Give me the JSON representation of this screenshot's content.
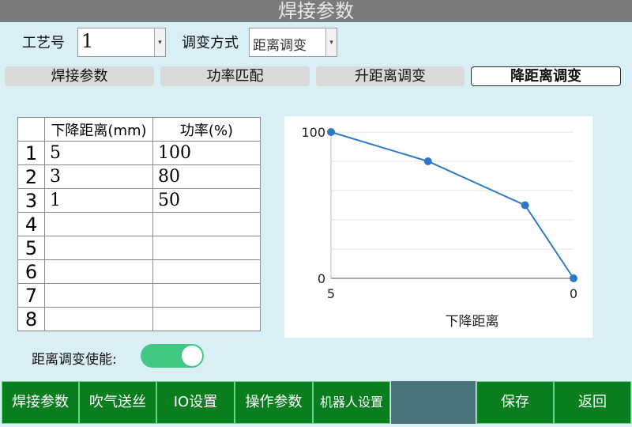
{
  "window": {
    "title": "焊接参数"
  },
  "header": {
    "process_label": "工艺号",
    "process_value": "1",
    "mode_label": "调变方式",
    "mode_value": "距离调变"
  },
  "tabs": [
    {
      "label": "焊接参数",
      "active": false
    },
    {
      "label": "功率匹配",
      "active": false
    },
    {
      "label": "升距离调变",
      "active": false
    },
    {
      "label": "降距离调变",
      "active": true
    }
  ],
  "table": {
    "columns": [
      "下降距离(mm)",
      "功率(%)"
    ],
    "rows": [
      {
        "num": "1",
        "distance": "5",
        "power": "100"
      },
      {
        "num": "2",
        "distance": "3",
        "power": "80"
      },
      {
        "num": "3",
        "distance": "1",
        "power": "50"
      },
      {
        "num": "4",
        "distance": "",
        "power": ""
      },
      {
        "num": "5",
        "distance": "",
        "power": ""
      },
      {
        "num": "6",
        "distance": "",
        "power": ""
      },
      {
        "num": "7",
        "distance": "",
        "power": ""
      },
      {
        "num": "8",
        "distance": "",
        "power": ""
      }
    ]
  },
  "chart_data": {
    "type": "line",
    "xlabel": "下降距离",
    "ylabel": "",
    "x_ticks": [
      "5",
      "0"
    ],
    "y_ticks": [
      "100",
      "0"
    ],
    "xlim": [
      5,
      0
    ],
    "ylim": [
      0,
      100
    ],
    "series": [
      {
        "x": [
          5,
          3,
          1,
          0
        ],
        "y": [
          100,
          80,
          50,
          0
        ]
      }
    ],
    "grid": true,
    "color": "#2f78c8"
  },
  "enable": {
    "label": "距离调变使能:",
    "on": true
  },
  "bottom_nav": {
    "welding_params": "焊接参数",
    "blow_feed": "吹气送丝",
    "io_settings": "IO设置",
    "operation_params": "操作参数",
    "robot_settings": "机器人设置",
    "save": "保存",
    "back": "返回"
  },
  "colors": {
    "background": "#d9eff5",
    "title_bar": "#7b7b7b",
    "nav_button": "#0a7d1e",
    "toggle_on": "#41c882",
    "chart_line": "#2f78c8"
  }
}
